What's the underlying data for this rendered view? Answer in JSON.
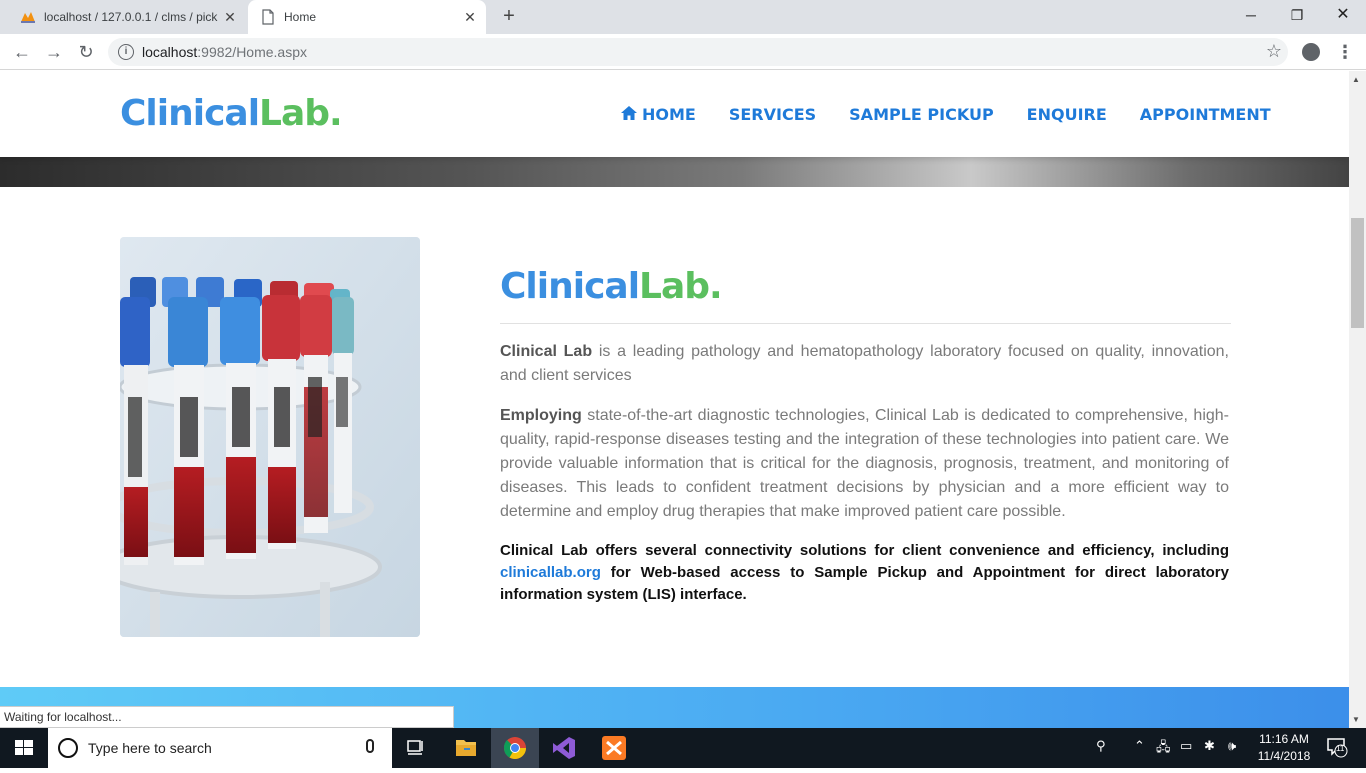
{
  "browser": {
    "tabs": [
      {
        "title": "localhost / 127.0.0.1 / clms / pick",
        "active": false
      },
      {
        "title": "Home",
        "active": true
      }
    ],
    "address": {
      "host": "localhost",
      "port_path": ":9982/Home.aspx"
    },
    "status": "Waiting for localhost..."
  },
  "site": {
    "logo": {
      "part1": "Clinical",
      "part2": "Lab."
    },
    "nav": [
      "HOME",
      "SERVICES",
      "SAMPLE PICKUP",
      "ENQUIRE",
      "APPOINTMENT"
    ],
    "about": {
      "logo": {
        "part1": "Clinical",
        "part2": "Lab."
      },
      "p1_bold": "Clinical Lab",
      "p1_rest": " is a leading pathology and hematopathology laboratory focused on quality, innovation, and client services",
      "p2_bold": "Employing",
      "p2_rest": " state-of-the-art diagnostic technologies, Clinical Lab is dedicated to comprehensive, high-quality, rapid-response diseases testing and the integration of these technologies into patient care. We provide valuable information that is critical for the diagnosis, prognosis, treatment, and monitoring of diseases. This leads to confident treatment decisions by physician and a more efficient way to determine and employ drug therapies that make improved patient care possible.",
      "p3_start": "Clinical Lab offers several connectivity solutions for client convenience and efficiency, including ",
      "p3_link": "clinicallab.org",
      "p3_end": " for Web-based access to Sample Pickup and Appointment for direct laboratory information system (LIS) interface."
    }
  },
  "taskbar": {
    "search_placeholder": "Type here to search",
    "time": "11:16 AM",
    "date": "11/4/2018",
    "notification_count": "11"
  },
  "colors": {
    "logo_blue": "#3b8fe0",
    "logo_green": "#5bbf5f",
    "nav_blue": "#1e7ad9"
  }
}
